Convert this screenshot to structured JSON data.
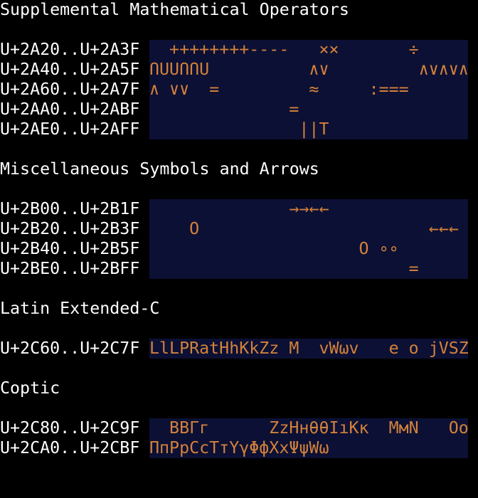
{
  "sections": [
    {
      "heading": "Supplemental Mathematical Operators",
      "rows": [
        {
          "range": "U+2A20..U+2A3F",
          "glyphs": "  ++++++++----   ××       ÷       "
        },
        {
          "range": "U+2A40..U+2A5F",
          "glyphs": "ՈՍՍՈՈՍ          ∧∨         ∧∨∧∨∧∧"
        },
        {
          "range": "U+2A60..U+2A7F",
          "glyphs": "∧ ∨∨  =         ≈     :===       "
        },
        {
          "range": "U+2AA0..U+2ABF",
          "glyphs": "              =                   "
        },
        {
          "range": "U+2AE0..U+2AFF",
          "glyphs": "               ∣∣T                "
        }
      ]
    },
    {
      "heading": "Miscellaneous Symbols and Arrows",
      "rows": [
        {
          "range": "U+2B00..U+2B1F",
          "glyphs": "              →→←←                "
        },
        {
          "range": "U+2B20..U+2B3F",
          "glyphs": "    O                       ←←←   "
        },
        {
          "range": "U+2B40..U+2B5F",
          "glyphs": "                     O ∘∘         "
        },
        {
          "range": "U+2BE0..U+2BFF",
          "glyphs": "                          =       "
        }
      ]
    },
    {
      "heading": "Latin Extended-C",
      "rows": [
        {
          "range": "U+2C60..U+2C7F",
          "glyphs": "LlLPRatHhKkZz M  vWωv   e o jVSZ"
        }
      ]
    },
    {
      "heading": "Coptic",
      "rows": [
        {
          "range": "U+2C80..U+2C9F",
          "glyphs": "  BBΓг      ZzHнθθIıKκ  MмN   Oo"
        },
        {
          "range": "U+2CA0..U+2CBF",
          "glyphs": "ПпPpCcTтYγΦфXxΨψWω              "
        }
      ]
    }
  ]
}
